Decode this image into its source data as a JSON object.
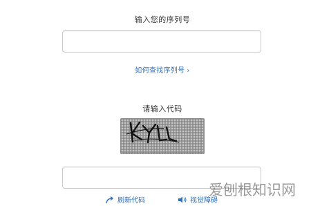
{
  "serial": {
    "label": "输入您的序列号",
    "value": "",
    "placeholder": ""
  },
  "find_serial_link": {
    "label": "如何查找序列号",
    "chevron": "›"
  },
  "captcha": {
    "label": "请输入代码",
    "image_text": "KYLL"
  },
  "code_input": {
    "value": "",
    "placeholder": ""
  },
  "actions": {
    "refresh_label": "刷新代码",
    "refresh_icon": "curved-arrow-icon",
    "listen_label": "视觉障碍",
    "listen_icon": "speaker-icon"
  },
  "watermark": {
    "text": "爱刨根知识网"
  },
  "colors": {
    "link": "#2d6fbd",
    "text": "#333333",
    "border": "#c9c9c9"
  }
}
